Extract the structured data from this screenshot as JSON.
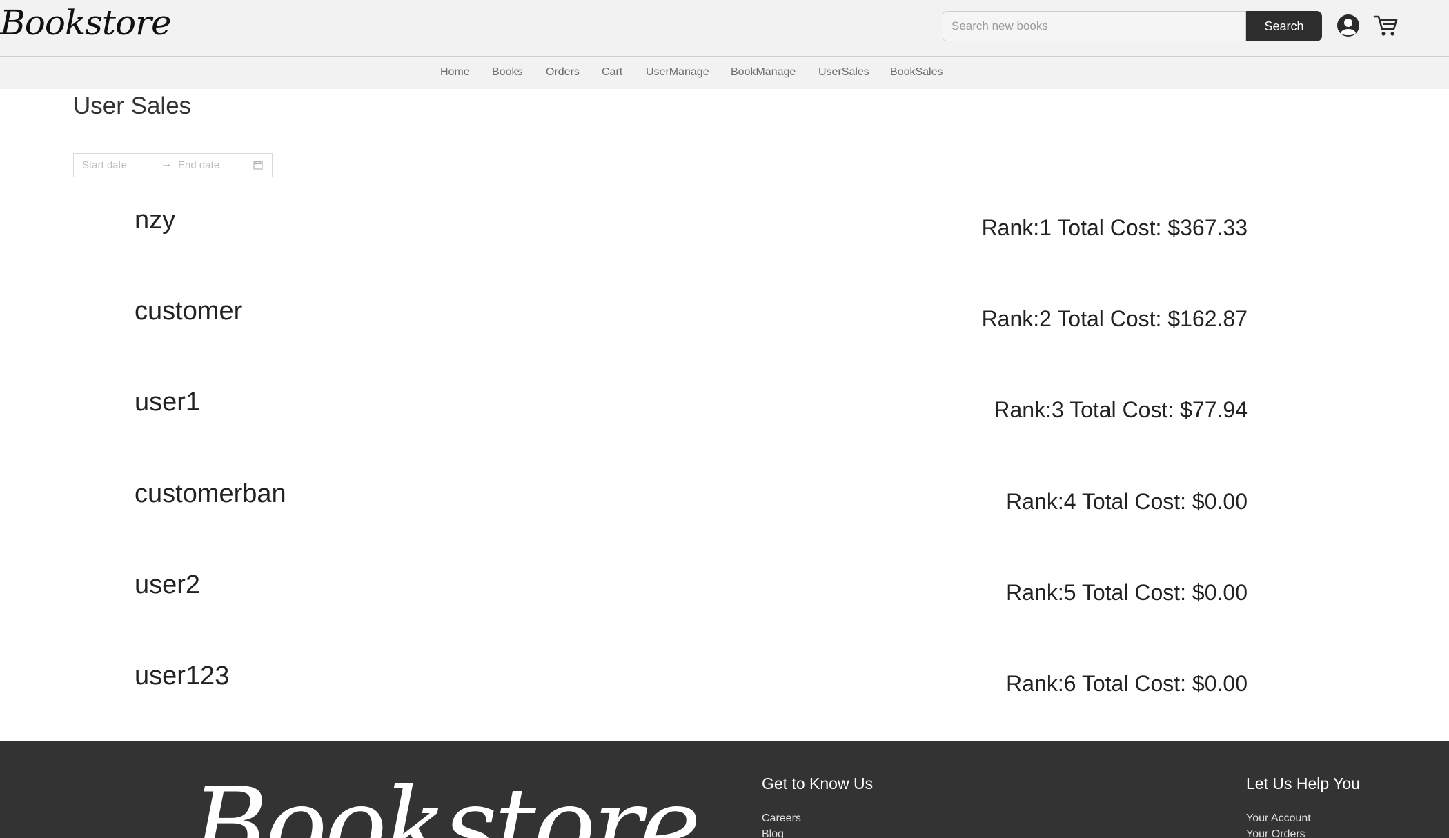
{
  "header": {
    "logo_text": "Bookstore",
    "search_placeholder": "Search new books",
    "search_button": "Search",
    "user_icon": "user-avatar-icon",
    "cart_icon": "shopping-cart-icon"
  },
  "nav": {
    "items": [
      "Home",
      "Books",
      "Orders",
      "Cart",
      "UserManage",
      "BookManage",
      "UserSales",
      "BookSales"
    ]
  },
  "page": {
    "title": "User Sales",
    "date_range": {
      "start_placeholder": "Start date",
      "separator": "→",
      "end_placeholder": "End date",
      "icon": "calendar-icon"
    }
  },
  "sales": [
    {
      "user": "nzy",
      "rank_text": "Rank:1 Total Cost: $367.33"
    },
    {
      "user": "customer",
      "rank_text": "Rank:2 Total Cost: $162.87"
    },
    {
      "user": "user1",
      "rank_text": "Rank:3 Total Cost: $77.94"
    },
    {
      "user": "customerban",
      "rank_text": "Rank:4 Total Cost: $0.00"
    },
    {
      "user": "user2",
      "rank_text": "Rank:5 Total Cost: $0.00"
    },
    {
      "user": "user123",
      "rank_text": "Rank:6 Total Cost: $0.00"
    }
  ],
  "footer": {
    "logo_text": "Bookstore",
    "col1": {
      "title": "Get to Know Us",
      "links": [
        "Careers",
        "Blog"
      ]
    },
    "col2": {
      "title": "Let Us Help You",
      "links": [
        "Your Account",
        "Your Orders"
      ]
    }
  },
  "colors": {
    "header_bg": "#f2f2f2",
    "search_button_bg": "#2d2d2d",
    "footer_bg": "#333333"
  }
}
